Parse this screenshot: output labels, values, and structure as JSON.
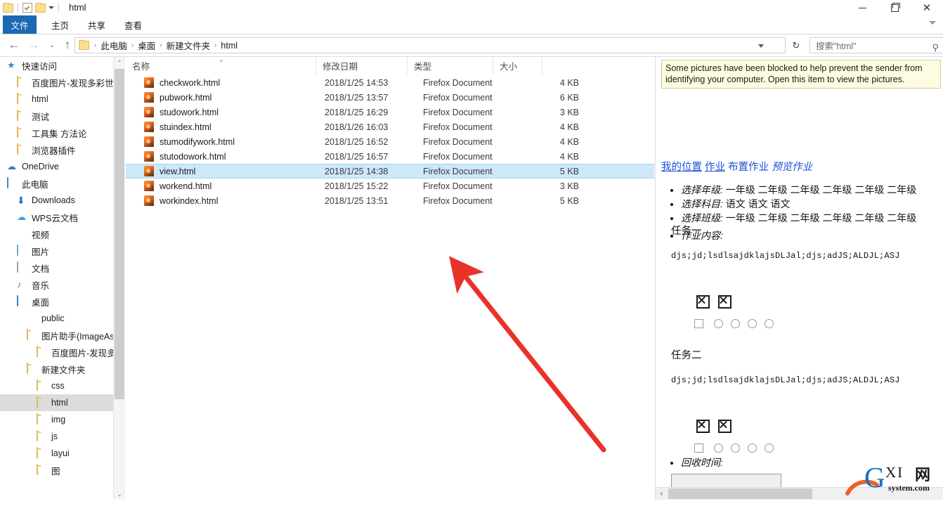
{
  "window": {
    "title": "html",
    "quick_access": [
      "folder-icon",
      "properties-icon",
      "new-folder-icon",
      "customize-caret-icon"
    ],
    "controls": {
      "minimize": "minimize-icon",
      "restore": "restore-icon",
      "close": "✕"
    }
  },
  "ribbon": {
    "tabs": [
      {
        "label": "文件",
        "active": true
      },
      {
        "label": "主页",
        "active": false
      },
      {
        "label": "共享",
        "active": false
      },
      {
        "label": "查看",
        "active": false
      }
    ],
    "expand_caret": "chevron-down-icon"
  },
  "address": {
    "back": "←",
    "forward": "→",
    "recent": "⌄",
    "up": "↑",
    "crumbs": [
      "此电脑",
      "桌面",
      "新建文件夹",
      "html"
    ],
    "separator": "›",
    "dropdown": "chevron-down-icon",
    "refresh": "↻"
  },
  "search": {
    "value": "搜索\"html\"",
    "placeholder": "搜索\"html\"",
    "icon": "search-icon"
  },
  "nav": {
    "items": [
      {
        "label": "快速访问",
        "icon": "star-icon",
        "indent": 0,
        "selected": false
      },
      {
        "label": "百度图片-发现多彩世",
        "icon": "folder-icon",
        "indent": 1,
        "selected": false,
        "pinned": true
      },
      {
        "label": "html",
        "icon": "folder-icon",
        "indent": 1,
        "selected": false
      },
      {
        "label": "测试",
        "icon": "folder-icon",
        "indent": 1,
        "selected": false
      },
      {
        "label": "工具集 方法论",
        "icon": "folder-icon",
        "indent": 1,
        "selected": false
      },
      {
        "label": "浏览器插件",
        "icon": "folder-icon",
        "indent": 1,
        "selected": false
      },
      {
        "label": "OneDrive",
        "icon": "onedrive-icon",
        "indent": 0,
        "selected": false
      },
      {
        "label": "此电脑",
        "icon": "this-pc-icon",
        "indent": 0,
        "selected": false
      },
      {
        "label": "Downloads",
        "icon": "downloads-icon",
        "indent": 1,
        "selected": false
      },
      {
        "label": "WPS云文档",
        "icon": "wps-cloud-icon",
        "indent": 1,
        "selected": false
      },
      {
        "label": "视频",
        "icon": "video-icon",
        "indent": 1,
        "selected": false
      },
      {
        "label": "图片",
        "icon": "pictures-icon",
        "indent": 1,
        "selected": false
      },
      {
        "label": "文档",
        "icon": "documents-icon",
        "indent": 1,
        "selected": false
      },
      {
        "label": "音乐",
        "icon": "music-icon",
        "indent": 1,
        "selected": false
      },
      {
        "label": "桌面",
        "icon": "desktop-icon",
        "indent": 1,
        "selected": false
      },
      {
        "label": "public",
        "icon": "synced-folder-icon",
        "indent": 2,
        "selected": false
      },
      {
        "label": "图片助手(ImageAssis",
        "icon": "folder-icon",
        "indent": 2,
        "selected": false
      },
      {
        "label": "百度图片-发现多彩世",
        "icon": "folder-icon",
        "indent": 3,
        "selected": false
      },
      {
        "label": "新建文件夹",
        "icon": "folder-icon",
        "indent": 2,
        "selected": false
      },
      {
        "label": "css",
        "icon": "folder-icon",
        "indent": 3,
        "selected": false
      },
      {
        "label": "html",
        "icon": "folder-icon",
        "indent": 3,
        "selected": true
      },
      {
        "label": "img",
        "icon": "folder-icon",
        "indent": 3,
        "selected": false
      },
      {
        "label": "js",
        "icon": "folder-icon",
        "indent": 3,
        "selected": false
      },
      {
        "label": "layui",
        "icon": "folder-icon",
        "indent": 3,
        "selected": false
      },
      {
        "label": "图",
        "icon": "folder-icon",
        "indent": 3,
        "selected": false
      }
    ],
    "scroll_up": "⌃",
    "scroll_down": "⌄"
  },
  "filelist": {
    "columns": [
      {
        "label": "名称",
        "key": "name"
      },
      {
        "label": "修改日期",
        "key": "date"
      },
      {
        "label": "类型",
        "key": "type"
      },
      {
        "label": "大小",
        "key": "size"
      }
    ],
    "sort_indicator": "⌃",
    "rows": [
      {
        "name": "checkwork.html",
        "date": "2018/1/25 14:53",
        "type": "Firefox Document",
        "size": "4 KB",
        "selected": false
      },
      {
        "name": "pubwork.html",
        "date": "2018/1/25 13:57",
        "type": "Firefox Document",
        "size": "6 KB",
        "selected": false
      },
      {
        "name": "studowork.html",
        "date": "2018/1/25 16:29",
        "type": "Firefox Document",
        "size": "3 KB",
        "selected": false
      },
      {
        "name": "stuindex.html",
        "date": "2018/1/26 16:03",
        "type": "Firefox Document",
        "size": "4 KB",
        "selected": false
      },
      {
        "name": "stumodifywork.html",
        "date": "2018/1/25 16:52",
        "type": "Firefox Document",
        "size": "4 KB",
        "selected": false
      },
      {
        "name": "stutodowork.html",
        "date": "2018/1/25 16:57",
        "type": "Firefox Document",
        "size": "4 KB",
        "selected": false
      },
      {
        "name": "view.html",
        "date": "2018/1/25 14:38",
        "type": "Firefox Document",
        "size": "5 KB",
        "selected": true
      },
      {
        "name": "workend.html",
        "date": "2018/1/25 15:22",
        "type": "Firefox Document",
        "size": "3 KB",
        "selected": false
      },
      {
        "name": "workindex.html",
        "date": "2018/1/25 13:51",
        "type": "Firefox Document",
        "size": "5 KB",
        "selected": false
      }
    ]
  },
  "annotation": {
    "type": "red-arrow",
    "color": "#e8322a",
    "points_at": "view.html"
  },
  "preview": {
    "blocked_notice": "Some pictures have been blocked to help prevent the sender from identifying your computer. Open this item to view the pictures.",
    "links": [
      {
        "label": "我的位置",
        "style": "underline"
      },
      {
        "label": "作业",
        "style": "underline"
      },
      {
        "label": "布置作业",
        "style": "plain"
      },
      {
        "label": "预览作业",
        "style": "italic"
      }
    ],
    "fields": [
      {
        "label": "选择年级:",
        "value": "一年级 二年级 二年级 二年级 二年级 二年级"
      },
      {
        "label": "选择科目:",
        "value": "语文 语文 语文"
      },
      {
        "label": "选择班级:",
        "value": "一年级 二年级 二年级 二年级 二年级 二年级"
      },
      {
        "label": "作业内容:",
        "value": ""
      }
    ],
    "tasks": [
      {
        "title": "任务一",
        "code": "djs;jd;lsdlsajdklajsDLJal;djs;adJS;ALDJL;ASJ"
      },
      {
        "title": "任务二",
        "code": "djs;jd;lsdlsajdklajsDLJal;djs;adJS;ALDJL;ASJ"
      }
    ],
    "recycle_label": "回收时间:",
    "recycle_value": "",
    "broken_image_icon": "broken-image-icon",
    "hscroll_left": "‹"
  },
  "watermark": {
    "g": "G",
    "xi": "XI",
    "wang": "网",
    "site": "system.com"
  }
}
